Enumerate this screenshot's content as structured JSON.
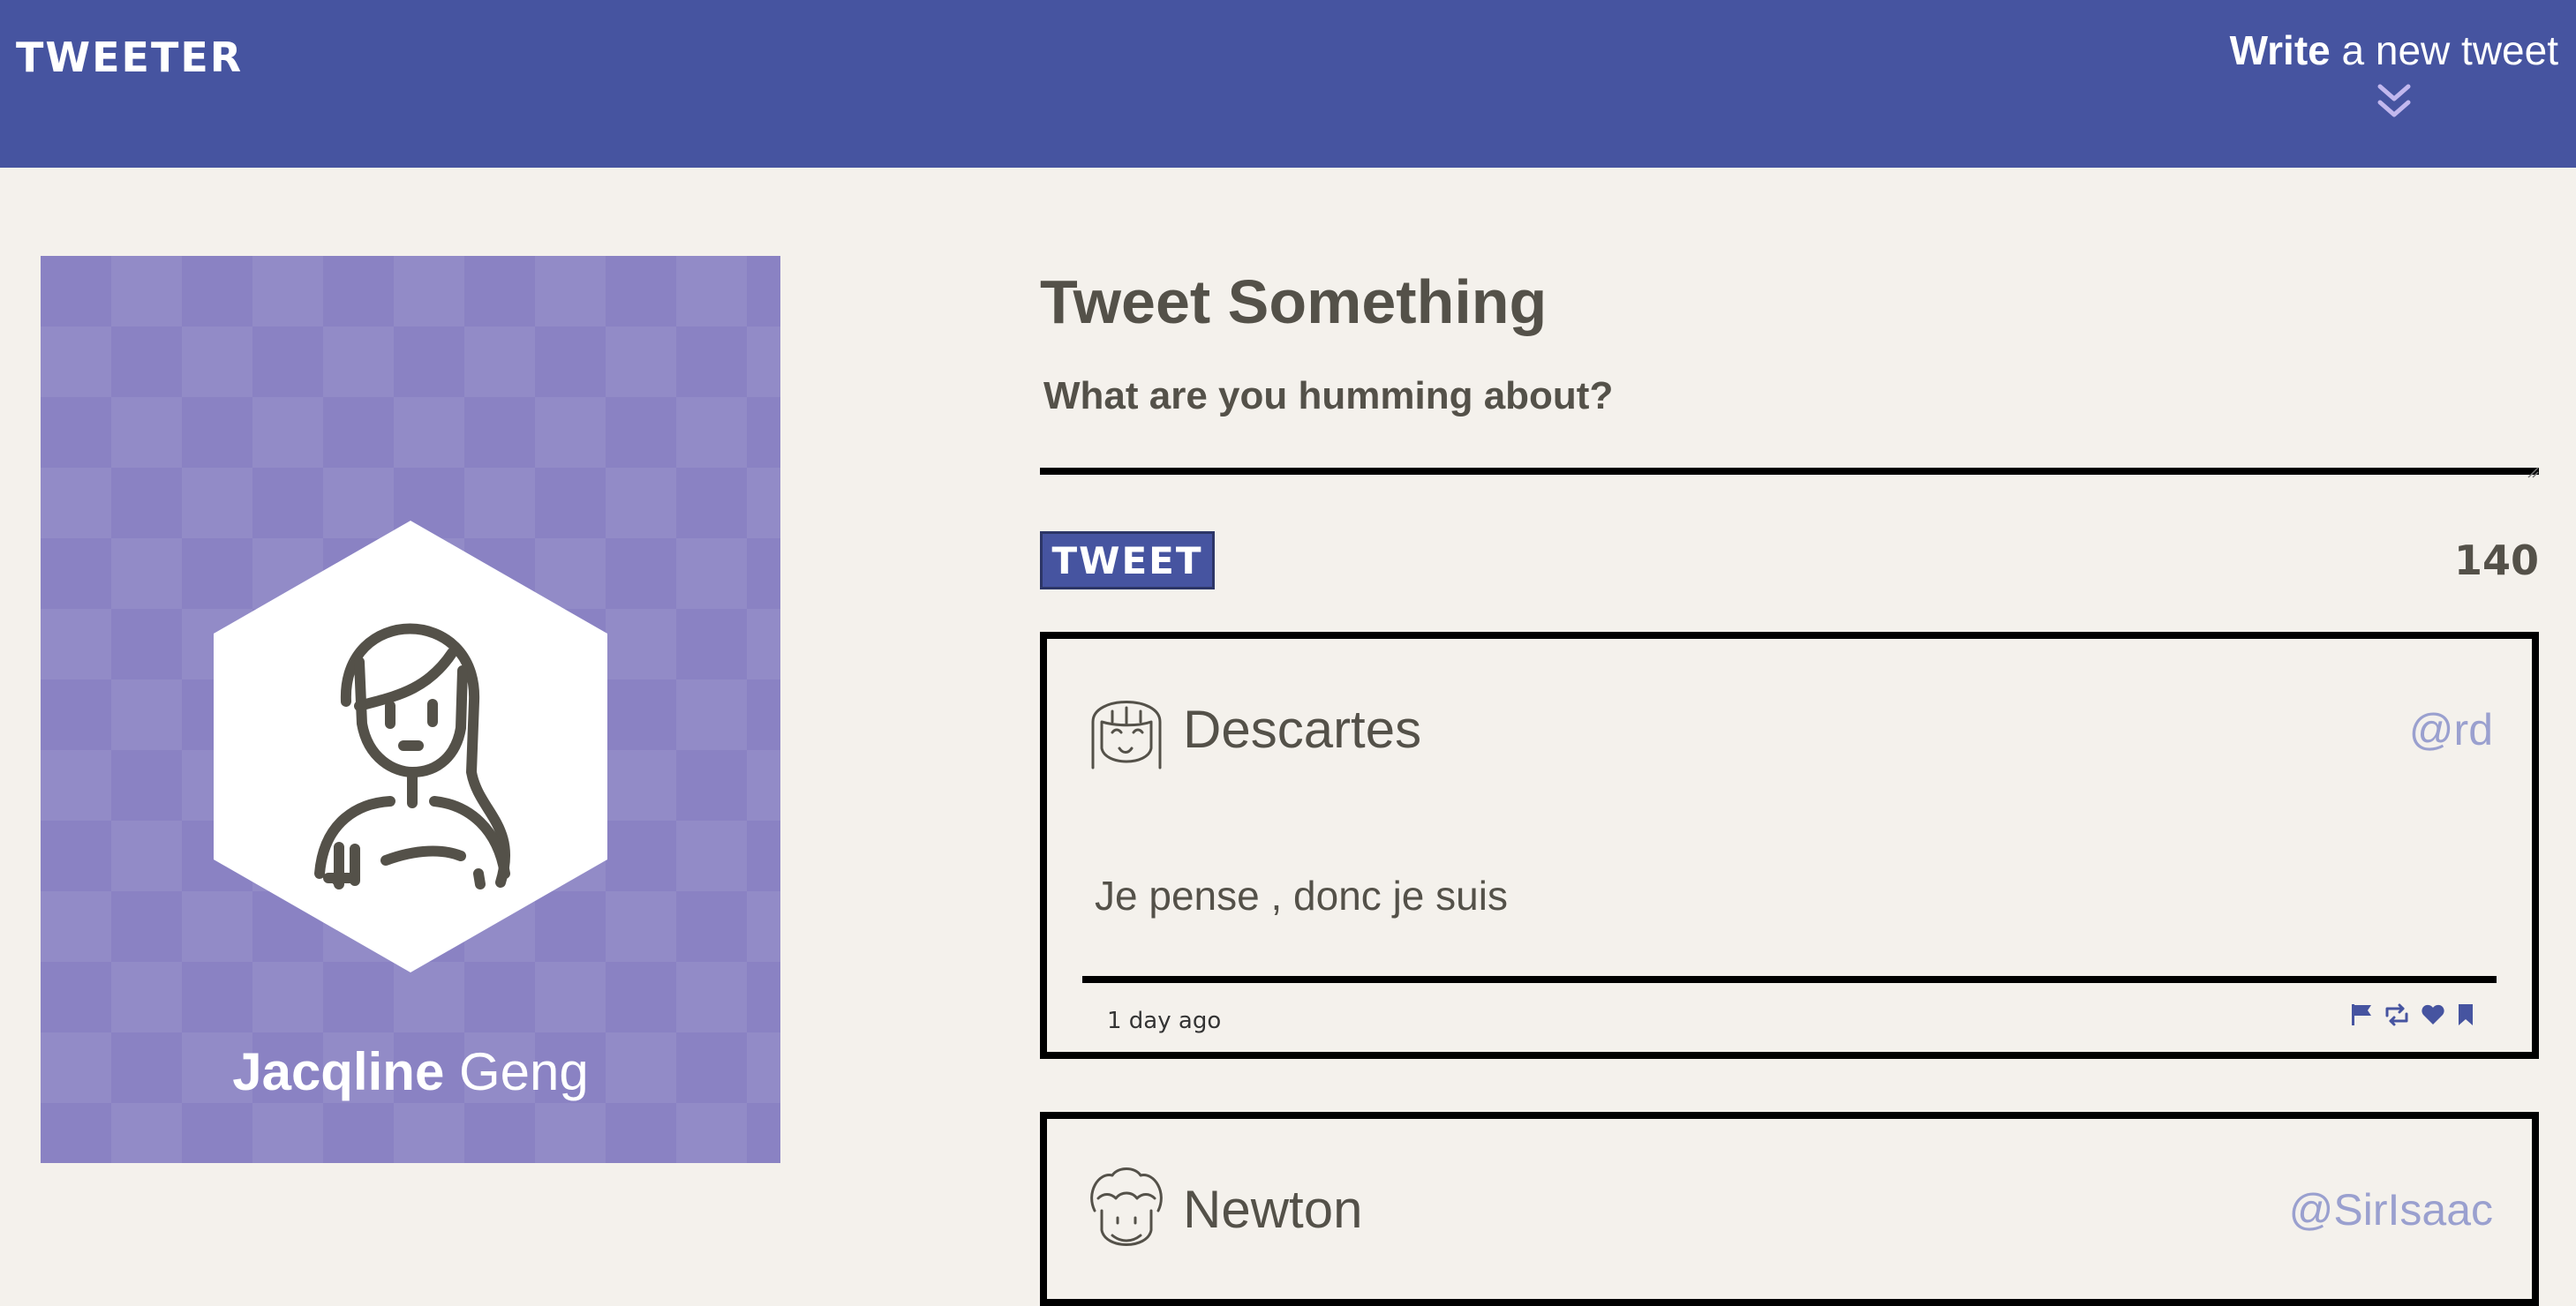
{
  "nav": {
    "brand": "TWEETER",
    "compose_bold": "Write",
    "compose_rest": " a new tweet",
    "compose_icon": "double-chevron-down-icon"
  },
  "profile": {
    "first_name": "Jacqline",
    "last_name": " Geng",
    "avatar_icon": "person-avatar-icon"
  },
  "composer": {
    "title": "Tweet Something",
    "placeholder": "What are you humming about?",
    "value": "",
    "button_label": "TWEET",
    "counter": "140"
  },
  "tweets": [
    {
      "name": "Descartes",
      "handle": "@rd",
      "body": "Je pense , donc je suis",
      "time": "1 day ago",
      "actions": [
        "flag-icon",
        "retweet-icon",
        "heart-icon",
        "bookmark-icon"
      ]
    },
    {
      "name": "Newton",
      "handle": "@SirIsaac"
    }
  ],
  "colors": {
    "nav": "#4654a0",
    "background": "#f4f1ec",
    "profile_card": "#8a82c3",
    "handle": "#9aa0cf",
    "text": "#545149"
  }
}
